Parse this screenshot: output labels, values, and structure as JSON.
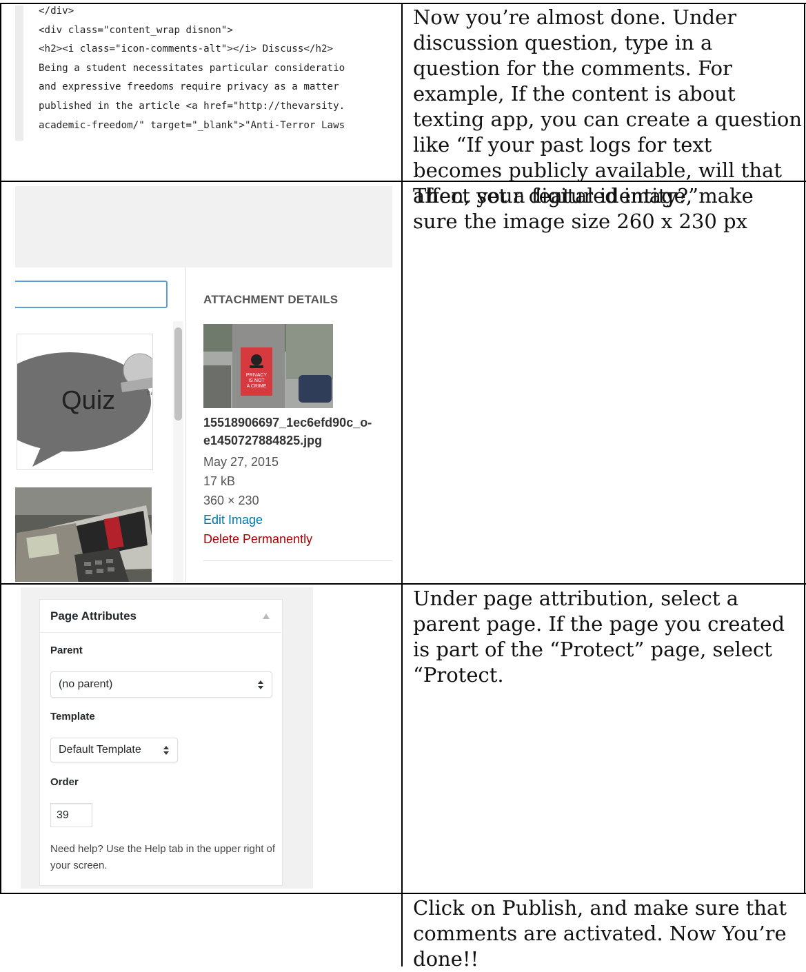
{
  "row1": {
    "code_lines": [
      "</div>",
      "<div class=\"content_wrap disnon\">",
      "<h2><i class=\"icon-comments-alt\"></i> Discuss</h2>",
      "Being a student necessitates particular consideratio",
      "and expressive freedoms require privacy as a matter",
      "published in the article <a href=\"http://thevarsity.",
      "academic-freedom/\" target=\"_blank\">\"Anti-Terror Laws"
    ],
    "instruction": "Now you’re almost done. Under discussion question, type in a question for the comments. For example, If the content is about texting app, you can create a question like “If your past logs for text becomes publicly available, will that affect your digital identity?”"
  },
  "row2": {
    "quiz_label": "Quiz",
    "quiz_badge": "Ear",
    "sticker_lines": [
      "PRIVACY",
      "IS NOT",
      "A CRIME"
    ],
    "attachment_title": "ATTACHMENT DETAILS",
    "filename": "15518906697_1ec6efd90c_o-e1450727884825.jpg",
    "date": "May 27, 2015",
    "size": "17 kB",
    "dimensions": "360 × 230",
    "edit_link": "Edit Image",
    "delete_link": "Delete Permanently",
    "link_color": "#0073aa",
    "delete_color": "#a00",
    "instruction": "Then, set a featured image, make sure the image size 260 x 230 px"
  },
  "row3": {
    "box_title": "Page Attributes",
    "parent_label": "Parent",
    "parent_value": "(no parent)",
    "template_label": "Template",
    "template_value": "Default Template",
    "order_label": "Order",
    "order_value": "39",
    "help_text": "Need help? Use the Help tab in the upper right of your screen.",
    "instruction": "Under page attribution, select  a parent page. If the page you created is part of the “Protect” page, select “Protect."
  },
  "row4": {
    "instruction": "Click on Publish, and make sure that comments are activated. Now You’re done!!"
  }
}
